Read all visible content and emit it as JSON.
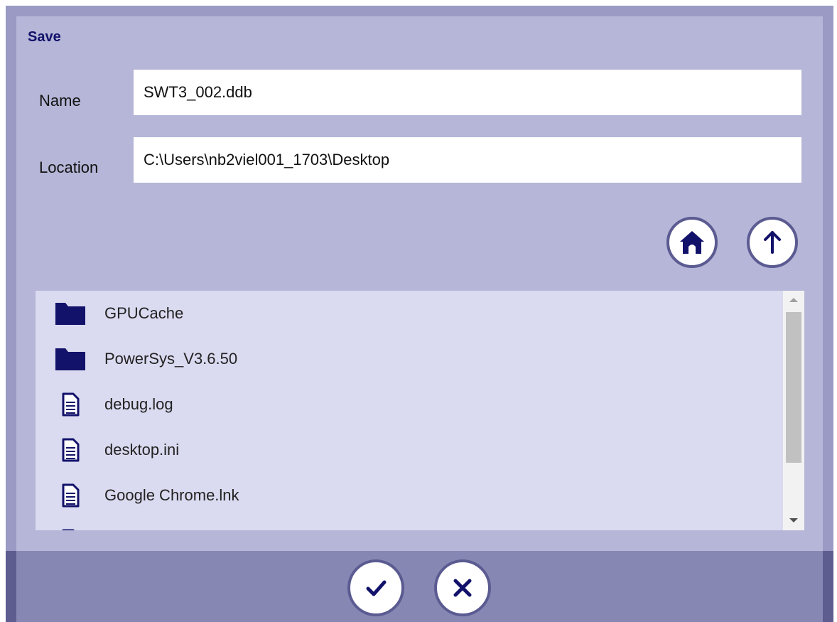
{
  "dialog": {
    "title": "Save"
  },
  "form": {
    "name_label": "Name",
    "name_value": "SWT3_002.ddb",
    "location_label": "Location",
    "location_value": "C:\\Users\\nb2viel001_1703\\Desktop"
  },
  "nav": {
    "home_icon": "home-icon",
    "up_icon": "arrow-up-icon"
  },
  "files": [
    {
      "name": "GPUCache",
      "type": "folder"
    },
    {
      "name": "PowerSys_V3.6.50",
      "type": "folder"
    },
    {
      "name": "debug.log",
      "type": "file"
    },
    {
      "name": "desktop.ini",
      "type": "file"
    },
    {
      "name": "Google Chrome.lnk",
      "type": "file"
    }
  ],
  "footer": {
    "confirm_icon": "checkmark-icon",
    "cancel_icon": "close-icon"
  },
  "colors": {
    "accent": "#12126b",
    "frame": "#9a9ac5",
    "panel": "#b6b6d8",
    "list_bg": "#dadaf0",
    "footer": "#8787b3"
  }
}
